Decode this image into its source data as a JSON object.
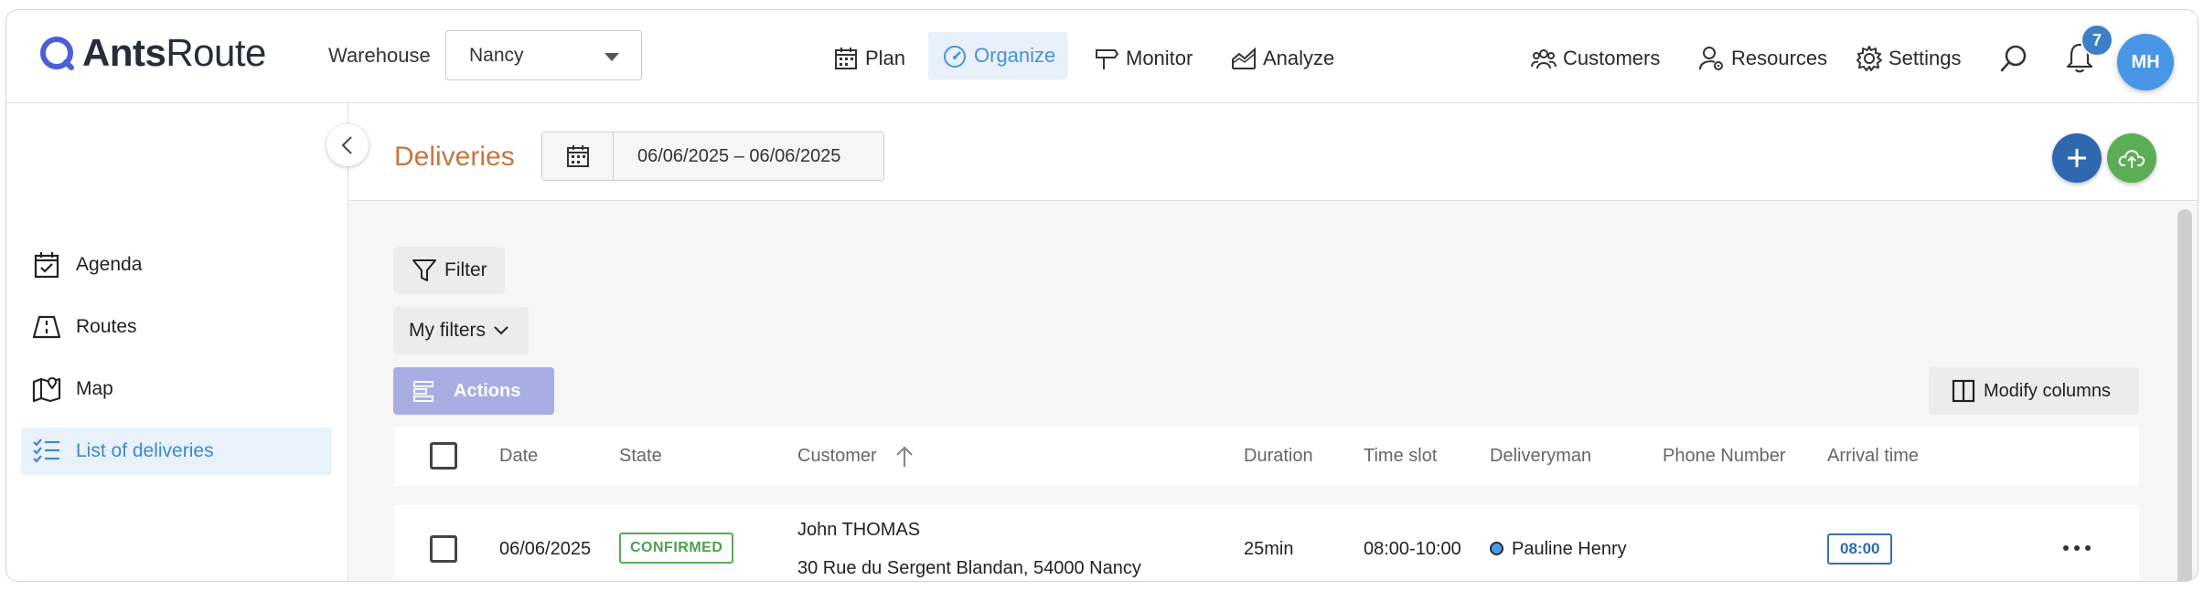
{
  "topbar": {
    "logo_brand_bold": "Ants",
    "logo_brand_light": "Route",
    "warehouse_label": "Warehouse",
    "warehouse_value": "Nancy",
    "nav": {
      "plan": "Plan",
      "organize": "Organize",
      "monitor": "Monitor",
      "analyze": "Analyze",
      "customers": "Customers",
      "resources": "Resources",
      "settings": "Settings"
    },
    "notification_count": "7",
    "avatar_initials": "MH",
    "active_nav": "organize",
    "accent_color": "#4a92d8"
  },
  "sidebar": {
    "items": [
      {
        "label": "Agenda",
        "icon": "calendar-check-icon"
      },
      {
        "label": "Routes",
        "icon": "road-icon"
      },
      {
        "label": "Map",
        "icon": "map-icon"
      },
      {
        "label": "List of deliveries",
        "icon": "checklist-icon",
        "active": true
      }
    ]
  },
  "header": {
    "title": "Deliveries",
    "date_range": "06/06/2025 – 06/06/2025",
    "title_color": "#c8763c"
  },
  "toolbar": {
    "filter_label": "Filter",
    "my_filters_label": "My filters",
    "actions_label": "Actions",
    "modify_columns_label": "Modify columns"
  },
  "table": {
    "columns": {
      "date": "Date",
      "state": "State",
      "customer": "Customer",
      "duration": "Duration",
      "time_slot": "Time slot",
      "deliveryman": "Deliveryman",
      "phone": "Phone Number",
      "arrival": "Arrival time"
    },
    "sort_column": "customer",
    "sort_direction": "ascending",
    "rows": [
      {
        "date": "06/06/2025",
        "state": "CONFIRMED",
        "customer_name": "John THOMAS",
        "customer_address": "30 Rue du Sergent Blandan, 54000 Nancy",
        "duration": "25min",
        "time_slot": "08:00-10:00",
        "deliveryman": "Pauline Henry",
        "phone": "",
        "arrival_time": "08:00"
      }
    ]
  }
}
